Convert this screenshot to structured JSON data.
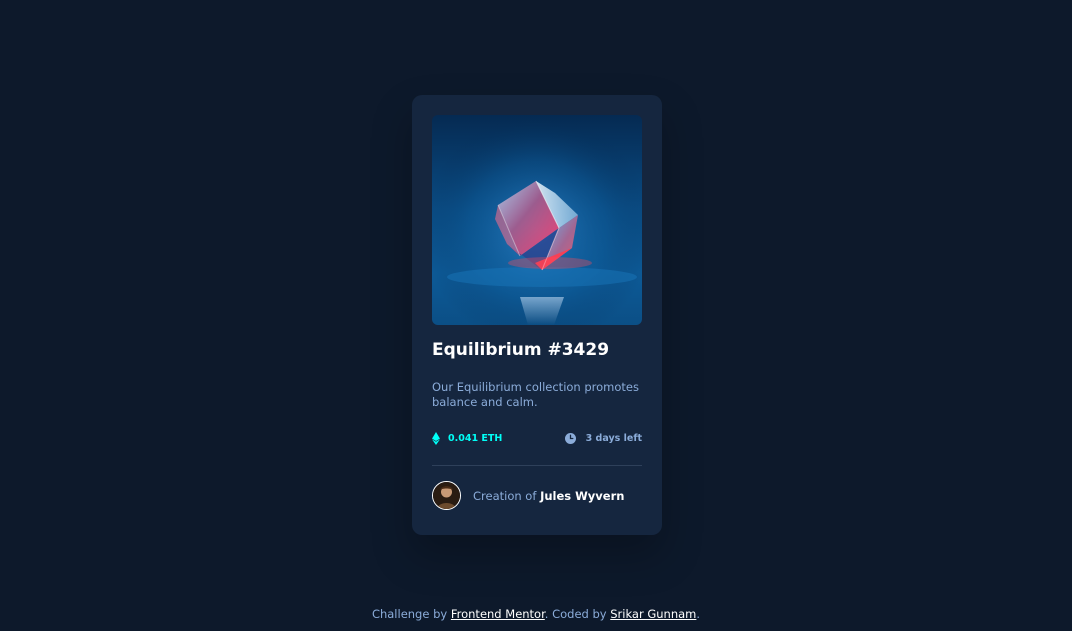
{
  "card": {
    "title": "Equilibrium #3429",
    "description": "Our Equilibrium collection promotes balance and calm.",
    "price": "0.041 ETH",
    "time_left": "3 days left",
    "creator_prefix": "Creation of",
    "creator_name": "Jules Wyvern",
    "image_icon": "equilibrium-cube-image",
    "price_icon": "ethereum-icon",
    "time_icon": "clock-icon"
  },
  "footer": {
    "challenge_prefix": "Challenge by",
    "challenge_link": "Frontend Mentor",
    "coded_prefix": ". Coded by",
    "coded_link": "Srikar Gunnam",
    "suffix": "."
  },
  "colors": {
    "background": "#0d192b",
    "card": "#15263f",
    "accent_cyan": "#00fff7",
    "soft_blue": "#8bacd9",
    "white": "#ffffff"
  }
}
